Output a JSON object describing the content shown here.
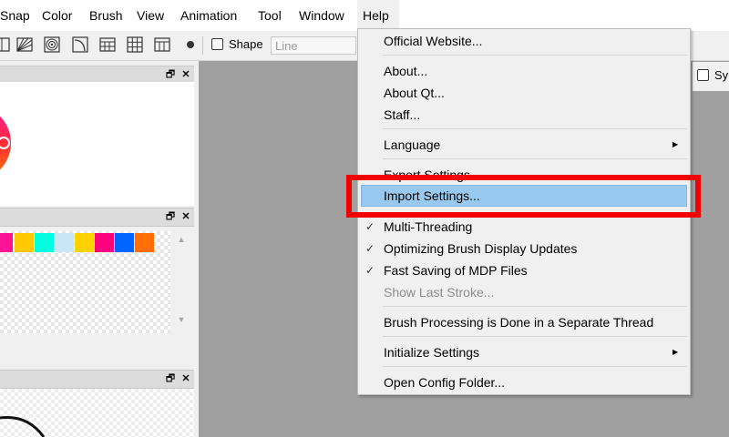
{
  "menubar": {
    "items": [
      {
        "label": "Snap"
      },
      {
        "label": "Color"
      },
      {
        "label": "Brush"
      },
      {
        "label": "View"
      },
      {
        "label": "Animation"
      },
      {
        "label": "Tool"
      },
      {
        "label": "Window"
      },
      {
        "label": "Help"
      }
    ]
  },
  "toolbar": {
    "shape_label": "Shape",
    "shape_value": "Line",
    "right_label": "Sy"
  },
  "palette": {
    "colors": [
      "#ff1493",
      "#ffc800",
      "#00ffe0",
      "#c8e6f5",
      "#ffd200",
      "#ff007f",
      "#0064ff",
      "#ff6e00"
    ]
  },
  "help_menu": {
    "official_website": "Official Website...",
    "about": "About...",
    "about_qt": "About Qt...",
    "staff": "Staff...",
    "language": "Language",
    "export_settings": "Export Settings...",
    "import_settings": "Import Settings...",
    "multi_threading": "Multi-Threading",
    "optimizing_brush": "Optimizing Brush Display Updates",
    "fast_saving": "Fast Saving of MDP Files",
    "show_last_stroke": "Show Last Stroke...",
    "brush_processing": "Brush Processing is Done in a Separate Thread",
    "initialize_settings": "Initialize Settings",
    "open_config": "Open Config Folder..."
  },
  "colors": {
    "highlight": "#99c9ef",
    "annotation": "#f20000",
    "canvas_bg": "#a0a0a0"
  }
}
